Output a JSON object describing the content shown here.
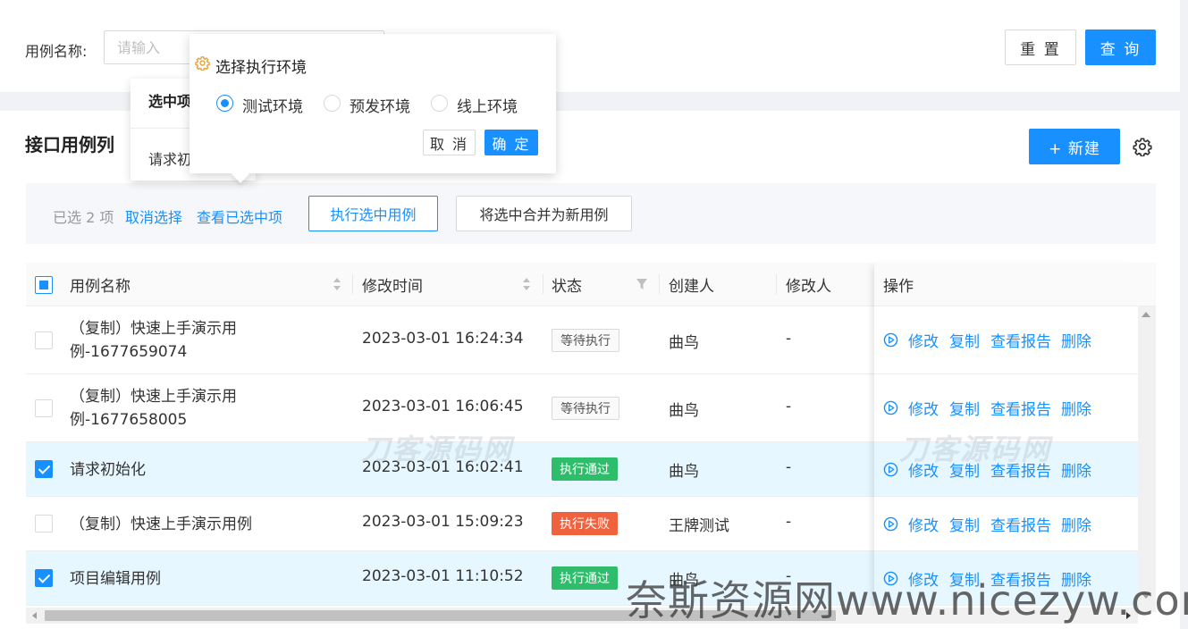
{
  "search": {
    "label": "用例名称:",
    "placeholder": "请输入",
    "reset_label": "重 置",
    "query_label": "查 询"
  },
  "header": {
    "title": "接口用例列",
    "new_label": "+ 新建",
    "settings_icon": "gear-icon"
  },
  "selection": {
    "count_text": "已选 2 项",
    "cancel_label": "取消选择",
    "view_label": "查看已选中项",
    "execute_label": "执行选中用例",
    "merge_label": "将选中合并为新用例"
  },
  "table": {
    "columns": {
      "name": "用例名称",
      "time": "修改时间",
      "status": "状态",
      "creator": "创建人",
      "modifier": "修改人",
      "actions": "操作"
    },
    "rows": [
      {
        "name": "（复制）快速上手演示用例-1677659074",
        "time": "2023-03-01 16:24:34",
        "status": "等待执行",
        "creator": "曲鸟",
        "modifier": "-",
        "checked": false
      },
      {
        "name": "（复制）快速上手演示用例-1677658005",
        "time": "2023-03-01 16:06:45",
        "status": "等待执行",
        "creator": "曲鸟",
        "modifier": "-",
        "checked": false
      },
      {
        "name": "请求初始化",
        "time": "2023-03-01 16:02:41",
        "status": "执行通过",
        "creator": "曲鸟",
        "modifier": "-",
        "checked": true
      },
      {
        "name": "（复制）快速上手演示用例",
        "time": "2023-03-01 15:09:23",
        "status": "执行失败",
        "creator": "王牌测试",
        "modifier": "-",
        "checked": false
      },
      {
        "name": "项目编辑用例",
        "time": "2023-03-01 11:10:52",
        "status": "执行通过",
        "creator": "曲鸟",
        "modifier": "-",
        "checked": true
      }
    ],
    "actions": {
      "edit": "修改",
      "copy": "复制",
      "report": "查看报告",
      "delete": "删除"
    }
  },
  "popover_back": {
    "title": "选中项",
    "body": "请求初"
  },
  "popover": {
    "title": "选择执行环境",
    "options": [
      "测试环境",
      "预发环境",
      "线上环境"
    ],
    "selected": "测试环境",
    "cancel_label": "取 消",
    "ok_label": "确 定"
  },
  "watermarks": {
    "center": "刀客源码网",
    "right": "刀客源码网",
    "footer": "奈斯资源网www.nicezyw.com"
  },
  "colors": {
    "primary": "#1890ff",
    "pass": "#2ebd6b",
    "fail": "#f0623e",
    "selected_row": "#e6f7ff"
  }
}
